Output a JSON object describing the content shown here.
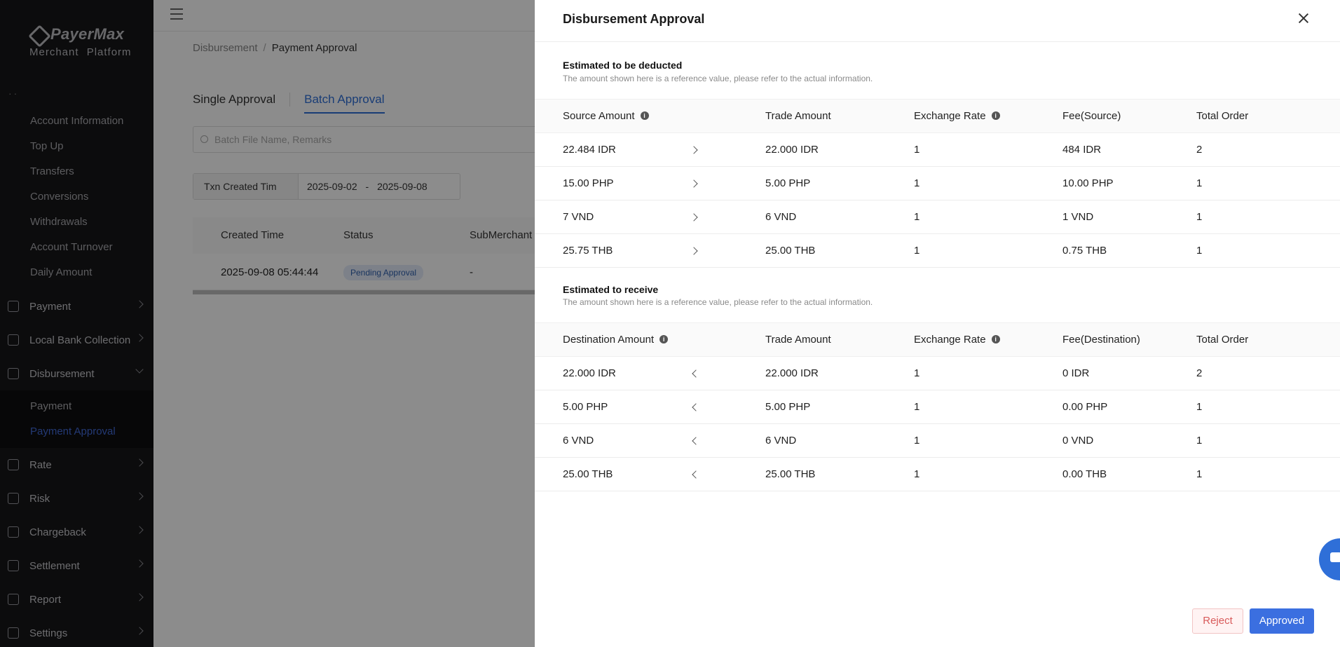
{
  "brand": {
    "name": "PayerMax",
    "subtitle": "Merchant  Platform"
  },
  "sidebar": {
    "dots": "··",
    "account_items": [
      {
        "label": "Account Information"
      },
      {
        "label": "Top Up"
      },
      {
        "label": "Transfers"
      },
      {
        "label": "Conversions"
      },
      {
        "label": "Withdrawals"
      },
      {
        "label": "Account Turnover"
      },
      {
        "label": "Daily Amount"
      }
    ],
    "groups": [
      {
        "label": "Payment",
        "icon": "document-icon"
      },
      {
        "label": "Local Bank Collection",
        "icon": "bank-icon"
      },
      {
        "label": "Disbursement",
        "icon": "disbursement-icon"
      },
      {
        "label": "Rate",
        "icon": "exchange-icon"
      },
      {
        "label": "Risk",
        "icon": "shield-icon"
      },
      {
        "label": "Chargeback",
        "icon": "chargeback-icon"
      },
      {
        "label": "Settlement",
        "icon": "settlement-icon"
      },
      {
        "label": "Report",
        "icon": "report-icon"
      },
      {
        "label": "Settings",
        "icon": "settings-icon"
      }
    ],
    "disbursement_sub": [
      {
        "label": "Payment"
      },
      {
        "label": "Payment Approval",
        "active": true
      }
    ]
  },
  "breadcrumb": {
    "parent": "Disbursement",
    "separator": "/",
    "current": "Payment Approval"
  },
  "tabs": {
    "single": "Single Approval",
    "batch": "Batch Approval"
  },
  "search": {
    "placeholder": "Batch File Name, Remarks"
  },
  "filter": {
    "field": "Txn Created Tim",
    "date_from": "2025-09-02",
    "date_sep": "-",
    "date_to": "2025-09-08"
  },
  "list": {
    "headers": {
      "created": "Created Time",
      "status": "Status",
      "submerchant": "SubMerchant"
    },
    "row": {
      "created": "2025-09-08 05:44:44",
      "status": "Pending Approval",
      "submerchant": "-"
    }
  },
  "drawer": {
    "title": "Disbursement Approval",
    "deducted": {
      "title": "Estimated to be deducted",
      "note": "The amount shown here is a reference value, please refer to the actual information.",
      "headers": {
        "amount": "Source Amount",
        "trade": "Trade Amount",
        "rate": "Exchange Rate",
        "fee": "Fee(Source)",
        "total": "Total Order"
      },
      "rows": [
        {
          "amount": "22.484 IDR",
          "trade": "22.000 IDR",
          "rate": "1",
          "fee": "484 IDR",
          "total": "2"
        },
        {
          "amount": "15.00 PHP",
          "trade": "5.00 PHP",
          "rate": "1",
          "fee": "10.00 PHP",
          "total": "1"
        },
        {
          "amount": "7 VND",
          "trade": "6 VND",
          "rate": "1",
          "fee": "1 VND",
          "total": "1"
        },
        {
          "amount": "25.75 THB",
          "trade": "25.00 THB",
          "rate": "1",
          "fee": "0.75 THB",
          "total": "1"
        }
      ]
    },
    "receive": {
      "title": "Estimated to receive",
      "note": "The amount shown here is a reference value, please refer to the actual information.",
      "headers": {
        "amount": "Destination Amount",
        "trade": "Trade Amount",
        "rate": "Exchange Rate",
        "fee": "Fee(Destination)",
        "total": "Total Order"
      },
      "rows": [
        {
          "amount": "22.000 IDR",
          "trade": "22.000 IDR",
          "rate": "1",
          "fee": "0 IDR",
          "total": "2"
        },
        {
          "amount": "5.00 PHP",
          "trade": "5.00 PHP",
          "rate": "1",
          "fee": "0.00 PHP",
          "total": "1"
        },
        {
          "amount": "6 VND",
          "trade": "6 VND",
          "rate": "1",
          "fee": "0 VND",
          "total": "1"
        },
        {
          "amount": "25.00 THB",
          "trade": "25.00 THB",
          "rate": "1",
          "fee": "0.00 THB",
          "total": "1"
        }
      ]
    },
    "buttons": {
      "reject": "Reject",
      "approve": "Approved"
    }
  }
}
